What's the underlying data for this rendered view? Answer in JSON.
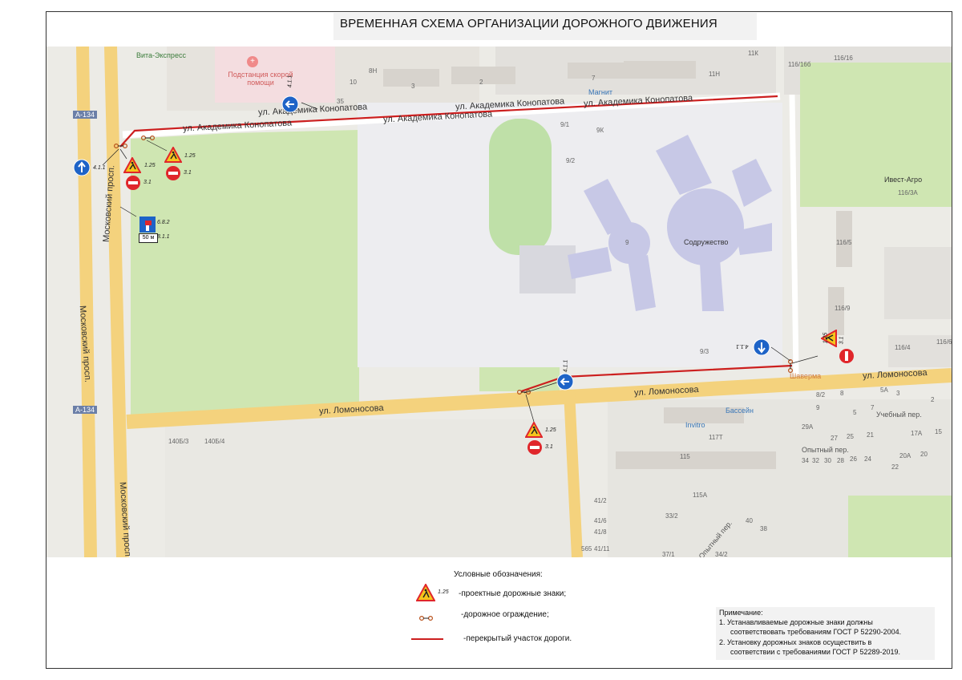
{
  "title": "ВРЕМЕННАЯ СХЕМА  ОРГАНИЗАЦИИ ДОРОЖНОГО ДВИЖЕНИЯ",
  "streets": {
    "akademika_1": "ул. Академика Конопатова",
    "akademika_2": "ул. Академика Конопатова",
    "akademika_3": "ул. Академика Конопатова",
    "akademika_4": "ул. Академика Конопатова",
    "akademika_5": "ул. Академика Конопатова",
    "lomonosova_1": "ул. Ломоносова",
    "lomonosova_2": "ул. Ломоносова",
    "lomonosova_3": "ул. Ломоносова",
    "moskovsky_1": "Московский просп.",
    "moskovsky_2": "Московский просп.",
    "moskovsky_3": "Московский просп.",
    "uchebny": "Учебный пер.",
    "opytny": "Опытный пер.",
    "opytny_2": "Опытный пер.",
    "a134_1": "А-134",
    "a134_2": "А-134"
  },
  "pois": {
    "vita": "Вита-Экспресс",
    "ambulance": "Подстанция скорой помощи",
    "magnit": "Магнит",
    "sodruzhestvo": "Содружество",
    "invest_agro": "Ивест-Агро",
    "shaverma": "Шаверма",
    "basseyn": "Бассейн",
    "invitro": "Invitro"
  },
  "house_numbers": [
    "11К",
    "116/16б",
    "116/16",
    "10",
    "8Н",
    "35",
    "3",
    "2",
    "7",
    "11Н",
    "9/1",
    "9К",
    "9/2",
    "9",
    "9/3",
    "116/3А",
    "116/4",
    "116/5",
    "116/6",
    "116/9",
    "8/2",
    "8",
    "5А",
    "3",
    "2",
    "9",
    "5",
    "7",
    "29А",
    "27",
    "25",
    "21",
    "17А",
    "15",
    "34",
    "32",
    "30",
    "28",
    "26",
    "24",
    "20А",
    "20",
    "22",
    "115",
    "117Т",
    "115А",
    "33/2",
    "41/2",
    "41/6",
    "41/8",
    "41/11",
    "40",
    "38",
    "37/1",
    "34/2",
    "565",
    "140Б/3",
    "140Б/4"
  ],
  "signs": {
    "s_4_1_1": "4.1.1",
    "s_1_25": "1.25",
    "s_3_1": "3.1",
    "s_6_8_2": "6.8.2",
    "s_8_1_1": "8.1.1",
    "plate_50": "50 м"
  },
  "legend": {
    "title": "Условные обозначения:",
    "item_signs": "-проектные дорожные знаки;",
    "item_sign_code": "1.25",
    "item_barrier": "-дорожное ограждение;",
    "item_closed": "-перекрытый участок дороги."
  },
  "note": {
    "title": "Примечание:",
    "line1": "1.   Устанавливаемые дорожные знаки должны",
    "line2": "соответствовать требованиям ГОСТ Р 52290-2004.",
    "line3": "2.   Установку дорожных знаков осуществить в",
    "line4": "соответствии с требованиями ГОСТ Р 52289-2019."
  },
  "colors": {
    "closed_road": "#cc1f1f",
    "main_road": "#f4d27d",
    "park": "#cfe6b2",
    "sign_blue": "#1e63c7",
    "sign_red": "#e0262b",
    "sign_yellow": "#f5c51c"
  }
}
